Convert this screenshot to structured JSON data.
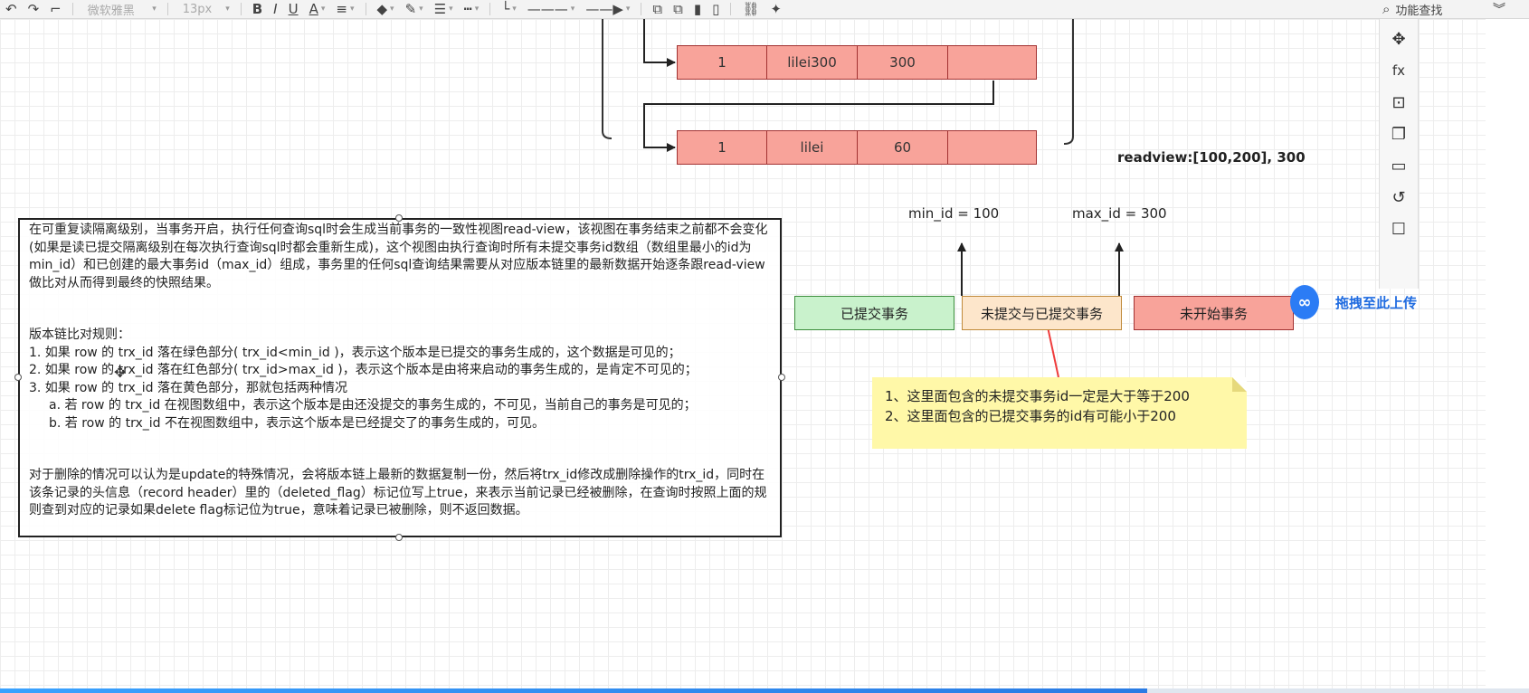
{
  "toolbar": {
    "font_name": "微软雅黑",
    "font_size": "13px",
    "bold": "B",
    "italic": "I",
    "underline": "U",
    "font_color": "A",
    "search_label": "功能查找"
  },
  "diagram": {
    "rows": [
      {
        "id": "1",
        "name": "lilei300",
        "balance": "300",
        "ptr": ""
      },
      {
        "id": "1",
        "name": "lilei",
        "balance": "60",
        "ptr": ""
      }
    ],
    "readview_label": "readview:[100,200], 300",
    "min_id_label": "min_id = 100",
    "max_id_label": "max_id = 300",
    "states": [
      {
        "label": "已提交事务",
        "color": "#c9f2cc"
      },
      {
        "label": "未提交与已提交事务",
        "color": "#fde6cb"
      },
      {
        "label": "未开始事务",
        "color": "#f8a39a"
      }
    ],
    "note_lines": [
      "1、这里面包含的未提交事务id一定是大于等于200",
      "2、这里面包含的已提交事务的id有可能小于200"
    ]
  },
  "textbox": {
    "intro": "在可重复读隔离级别，当事务开启，执行任何查询sql时会生成当前事务的一致性视图read-view，该视图在事务结束之前都不会变化(如果是读已提交隔离级别在每次执行查询sql时都会重新生成)，这个视图由执行查询时所有未提交事务id数组（数组里最小的id为min_id）和已创建的最大事务id（max_id）组成，事务里的任何sql查询结果需要从对应版本链里的最新数据开始逐条跟read-view做比对从而得到最终的快照结果。",
    "rules_title": "版本链比对规则：",
    "rule1": "1. 如果 row 的 trx_id 落在绿色部分( trx_id<min_id )，表示这个版本是已提交的事务生成的，这个数据是可见的；",
    "rule2": "2. 如果 row 的 trx_id 落在红色部分( trx_id>max_id )，表示这个版本是由将来启动的事务生成的，是肯定不可见的；",
    "rule3": "3. 如果 row 的 trx_id 落在黄色部分，那就包括两种情况",
    "rule3a": "a. 若 row 的 trx_id 在视图数组中，表示这个版本是由还没提交的事务生成的，不可见，当前自己的事务是可见的；",
    "rule3b": "b. 若 row 的 trx_id 不在视图数组中，表示这个版本是已经提交了的事务生成的，可见。",
    "delete_text": "对于删除的情况可以认为是update的特殊情况，会将版本链上最新的数据复制一份，然后将trx_id修改成删除操作的trx_id，同时在该条记录的头信息（record header）里的（deleted_flag）标记位写上true，来表示当前记录已经被删除，在查询时按照上面的规则查到对应的记录如果delete flag标记位为true，意味着记录已被删除，则不返回数据。"
  },
  "upload_label": "拖拽至此上传",
  "video_progress": 0.75
}
